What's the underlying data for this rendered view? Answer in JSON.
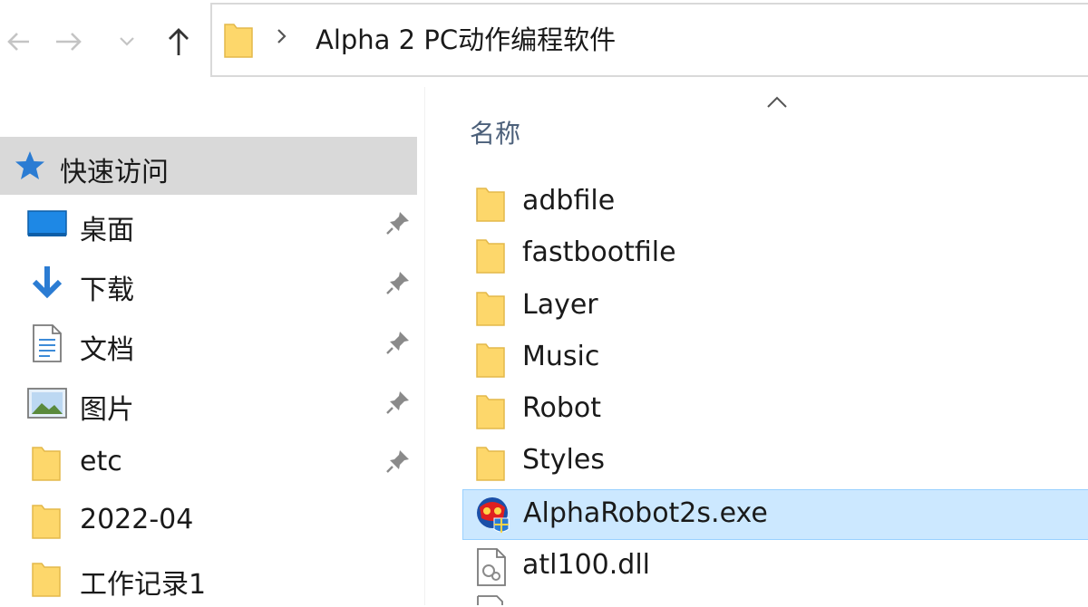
{
  "address": {
    "crumb": "Alpha 2 PC动作编程软件"
  },
  "sidebar": {
    "quick_access": "快速访问",
    "items": [
      {
        "label": "桌面",
        "icon": "desktop-icon",
        "pinned": true
      },
      {
        "label": "下载",
        "icon": "download-icon",
        "pinned": true
      },
      {
        "label": "文档",
        "icon": "document-icon",
        "pinned": true
      },
      {
        "label": "图片",
        "icon": "picture-icon",
        "pinned": true
      },
      {
        "label": "etc",
        "icon": "folder-icon",
        "pinned": true
      },
      {
        "label": "2022-04",
        "icon": "folder-icon",
        "pinned": false
      },
      {
        "label": "工作记录1",
        "icon": "folder-icon",
        "pinned": false
      }
    ]
  },
  "content": {
    "column_name": "名称",
    "files": [
      {
        "name": "adbfile",
        "type": "folder"
      },
      {
        "name": "fastbootfile",
        "type": "folder"
      },
      {
        "name": "Layer",
        "type": "folder"
      },
      {
        "name": "Music",
        "type": "folder"
      },
      {
        "name": "Robot",
        "type": "folder"
      },
      {
        "name": "Styles",
        "type": "folder"
      },
      {
        "name": "AlphaRobot2s.exe",
        "type": "exe",
        "selected": true
      },
      {
        "name": "atl100.dll",
        "type": "dll"
      }
    ]
  },
  "colors": {
    "folder_yellow": "#fdd76b",
    "selection_blue": "#cce8ff",
    "quick_access_bg": "#d9d9d9",
    "accent_blue": "#2b7cd3"
  }
}
